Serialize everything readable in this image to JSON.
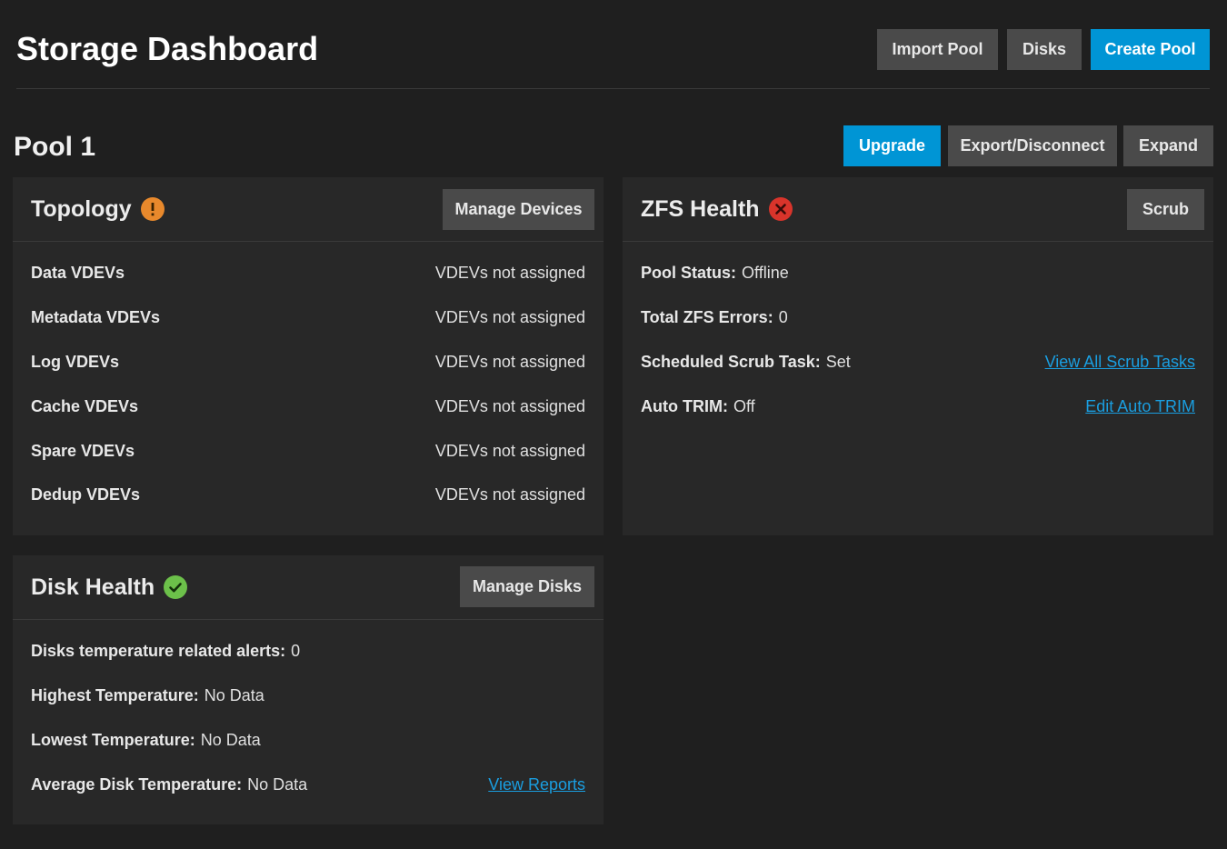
{
  "header": {
    "title": "Storage Dashboard",
    "buttons": {
      "import_pool": "Import Pool",
      "disks": "Disks",
      "create_pool": "Create Pool"
    }
  },
  "pool": {
    "name": "Pool 1",
    "buttons": {
      "upgrade": "Upgrade",
      "export_disconnect": "Export/Disconnect",
      "expand": "Expand"
    }
  },
  "topology": {
    "title": "Topology",
    "status_icon": "warning-icon",
    "status_color": "#e8892c",
    "manage_button": "Manage Devices",
    "rows": [
      {
        "label": "Data VDEVs",
        "value": "VDEVs not assigned"
      },
      {
        "label": "Metadata VDEVs",
        "value": "VDEVs not assigned"
      },
      {
        "label": "Log VDEVs",
        "value": "VDEVs not assigned"
      },
      {
        "label": "Cache VDEVs",
        "value": "VDEVs not assigned"
      },
      {
        "label": "Spare VDEVs",
        "value": "VDEVs not assigned"
      },
      {
        "label": "Dedup VDEVs",
        "value": "VDEVs not assigned"
      }
    ]
  },
  "zfs_health": {
    "title": "ZFS Health",
    "status_icon": "error-icon",
    "status_color": "#d9342b",
    "scrub_button": "Scrub",
    "rows": [
      {
        "label": "Pool Status",
        "value": "Offline"
      },
      {
        "label": "Total ZFS Errors",
        "value": "0"
      },
      {
        "label": "Scheduled Scrub Task",
        "value": "Set",
        "link": "View All Scrub Tasks"
      },
      {
        "label": "Auto TRIM",
        "value": "Off",
        "link": "Edit Auto TRIM"
      }
    ]
  },
  "disk_health": {
    "title": "Disk Health",
    "status_icon": "check-circle-icon",
    "status_color": "#6cc04a",
    "manage_button": "Manage Disks",
    "rows": [
      {
        "label": "Disks temperature related alerts",
        "value": "0"
      },
      {
        "label": "Highest Temperature",
        "value": "No Data"
      },
      {
        "label": "Lowest Temperature",
        "value": "No Data"
      },
      {
        "label": "Average Disk Temperature",
        "value": "No Data",
        "link": "View Reports"
      }
    ]
  },
  "colors": {
    "background": "#1f1f1f",
    "card": "#282828",
    "primary": "#0095d5",
    "secondary_button": "#4a4a4a",
    "link": "#1a9ee0"
  }
}
